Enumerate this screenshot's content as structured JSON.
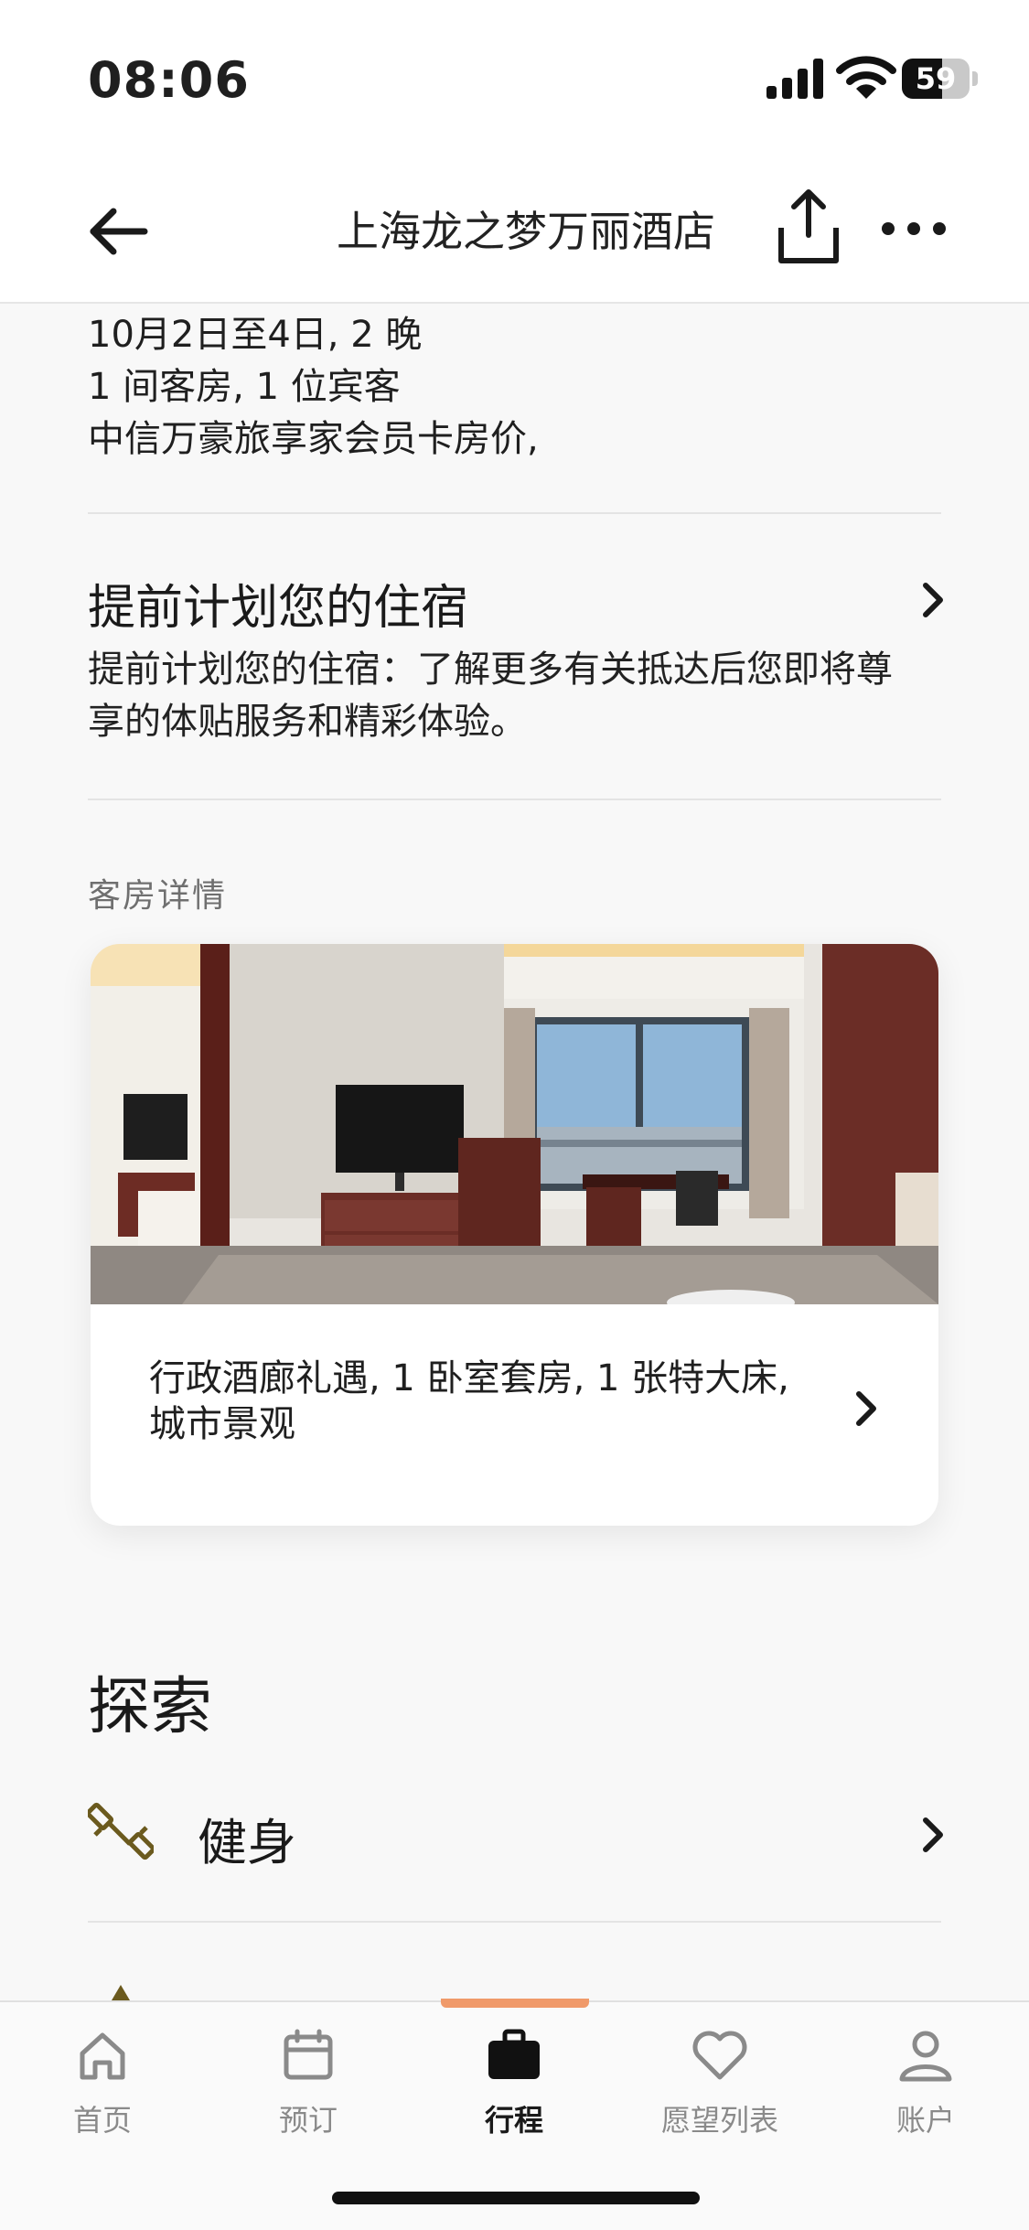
{
  "status_bar": {
    "time": "08:06",
    "battery": "59"
  },
  "nav": {
    "title": "上海龙之梦万丽酒店"
  },
  "stay": {
    "dates": "10月2日至4日, 2 晚",
    "guests": "1 间客房, 1 位宾客",
    "rate": "中信万豪旅享家会员卡房价,"
  },
  "plan": {
    "title": "提前计划您的住宿",
    "description": "提前计划您的住宿：了解更多有关抵达后您即将尊享的体贴服务和精彩体验。"
  },
  "room": {
    "section_label": "客房详情",
    "description": "行政酒廊礼遇, 1 卧室套房, 1 张特大床, 城市景观"
  },
  "explore": {
    "title": "探索",
    "items": [
      {
        "label": "健身",
        "icon": "dumbbell-icon"
      }
    ]
  },
  "tabs": [
    {
      "label": "首页",
      "icon": "home-icon"
    },
    {
      "label": "预订",
      "icon": "calendar-icon"
    },
    {
      "label": "行程",
      "icon": "suitcase-icon",
      "active": true
    },
    {
      "label": "愿望列表",
      "icon": "heart-icon"
    },
    {
      "label": "账户",
      "icon": "person-icon"
    }
  ],
  "colors": {
    "accent": "#f09a6a",
    "fitness_icon": "#6b5a1e"
  }
}
